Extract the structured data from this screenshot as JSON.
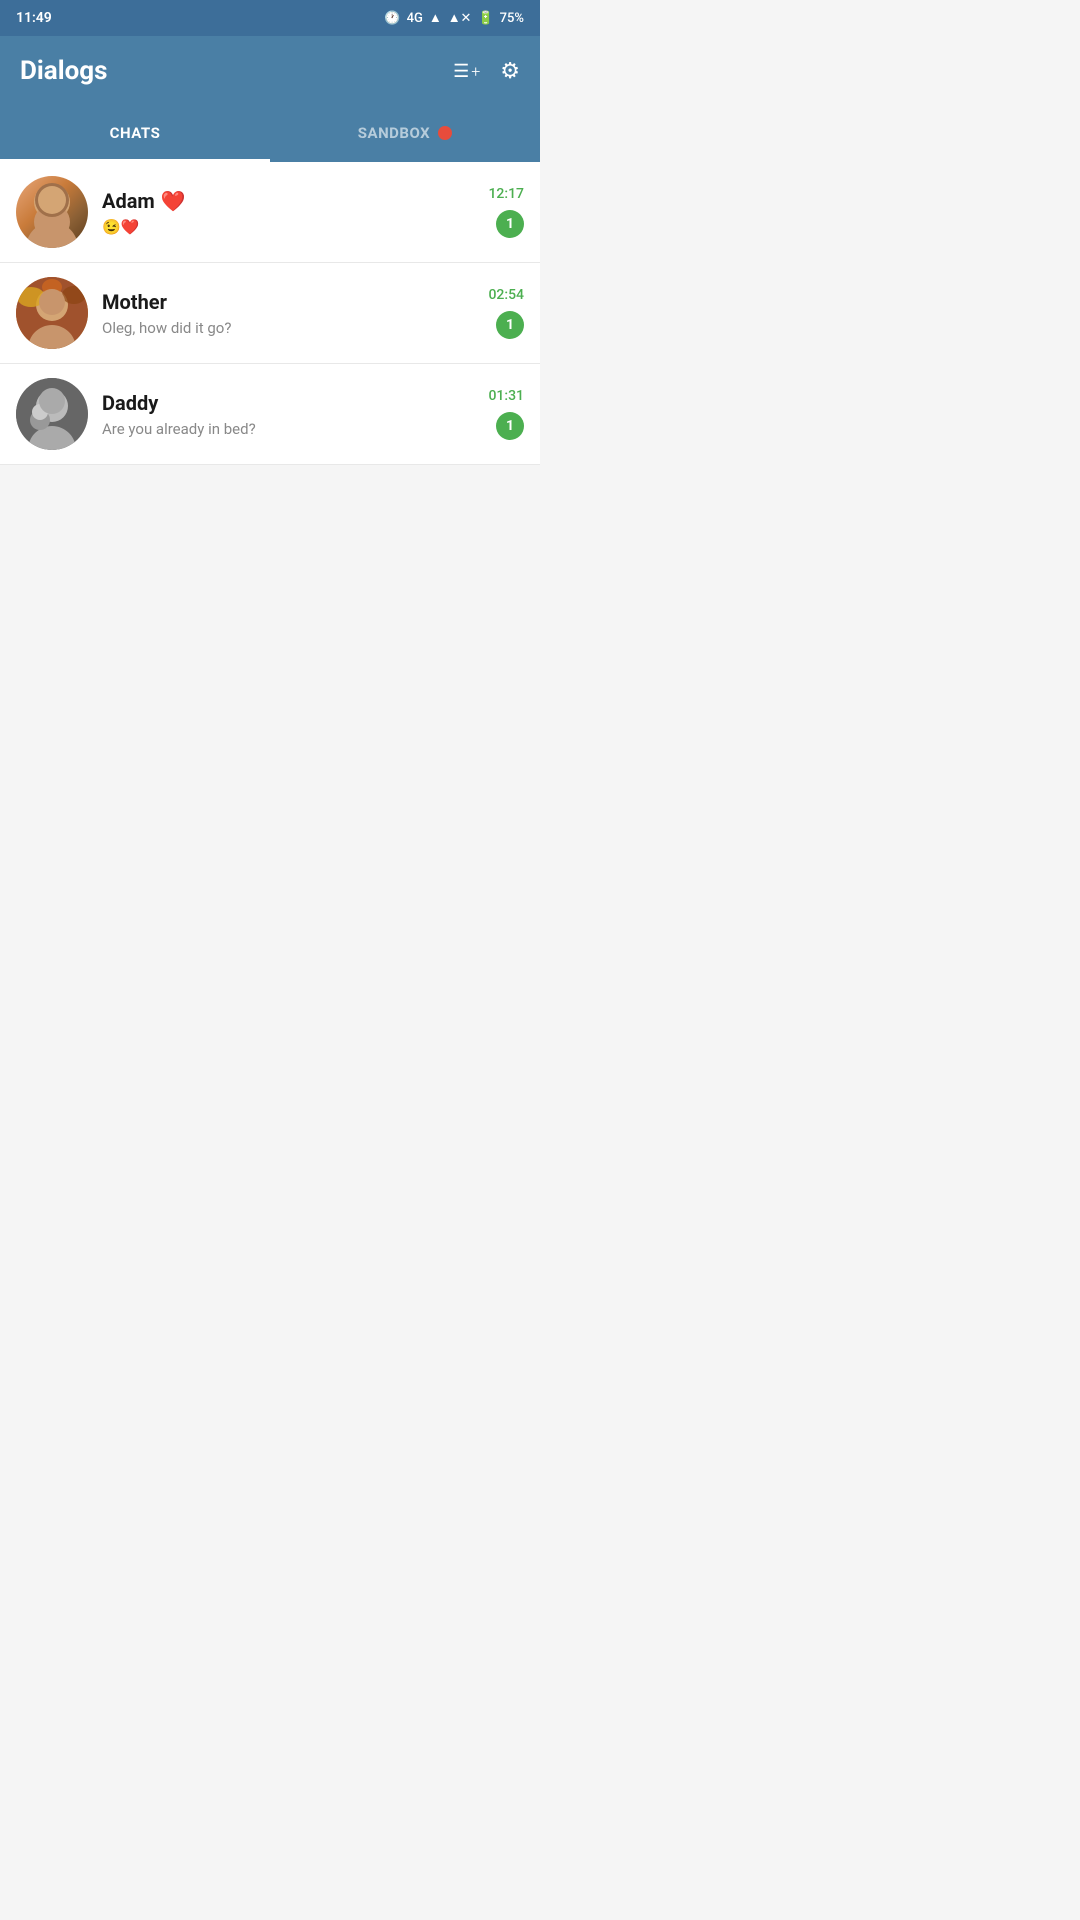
{
  "statusBar": {
    "time": "11:49",
    "network": "4G",
    "battery": "75%"
  },
  "appBar": {
    "title": "Dialogs",
    "newChatIcon": "≡+",
    "settingsIcon": "⚙"
  },
  "tabs": [
    {
      "id": "chats",
      "label": "CHATS",
      "active": true
    },
    {
      "id": "sandbox",
      "label": "SANDBOX",
      "active": false,
      "hasDot": true
    }
  ],
  "chats": [
    {
      "id": "adam",
      "name": "Adam",
      "nameEmoji": "❤️",
      "previewEmoji": "😉❤️",
      "preview": "",
      "time": "12:17",
      "unread": 1,
      "avatarStyle": "adam"
    },
    {
      "id": "mother",
      "name": "Mother",
      "nameEmoji": "",
      "preview": "Oleg, how did it go?",
      "time": "02:54",
      "unread": 1,
      "avatarStyle": "mother"
    },
    {
      "id": "daddy",
      "name": "Daddy",
      "nameEmoji": "",
      "preview": "Are you already in bed?",
      "time": "01:31",
      "unread": 1,
      "avatarStyle": "daddy"
    }
  ],
  "colors": {
    "headerBg": "#4a7fa5",
    "statusBg": "#3d6e99",
    "activeTab": "#ffffff",
    "inactiveTab": "rgba(255,255,255,0.6)",
    "unreadBadge": "#4caf50",
    "sandboxDot": "#e74c3c",
    "timeColor": "#4caf50"
  }
}
